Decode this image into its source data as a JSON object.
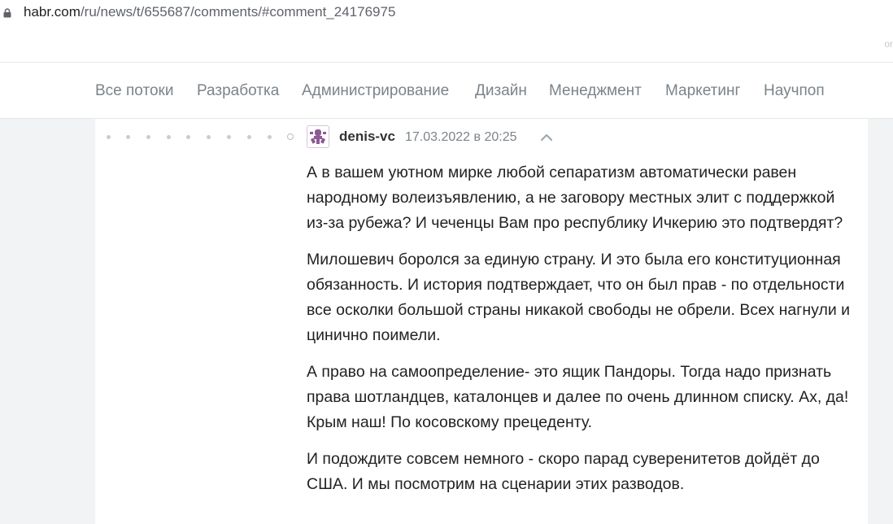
{
  "browser": {
    "url_host": "habr.com",
    "url_path": "/ru/news/t/655687/comments/#comment_24176975"
  },
  "top_strip": {
    "tail_text": "or"
  },
  "nav": {
    "items": [
      {
        "label": "Все потоки"
      },
      {
        "label": "Разработка"
      },
      {
        "label": "Администрирование"
      },
      {
        "label": "Дизайн"
      },
      {
        "label": "Менеджмент"
      },
      {
        "label": "Маркетинг"
      },
      {
        "label": "Научпоп"
      }
    ]
  },
  "comment": {
    "username": "denis-vc",
    "date": "17.03.2022 в 20:25",
    "avatar_color": "#8e5a94",
    "paragraphs": [
      "А в вашем уютном мирке любой сепаратизм автоматически равен народному волеизъявлению, а не заговору местных элит с поддержкой из-за рубежа? И чеченцы Вам про республику Ичкерию это подтвердят?",
      "Милошевич боролся за единую страну. И это была его конституционная обязанность. И история подтверждает, что он был прав - по отдельности все осколки большой страны никакой свободы не обрели. Всех нагнули и цинично поимели.",
      "А право на самоопределение- это ящик Пандоры. Тогда надо признать права шотландцев, каталонцев и далее по очень длинном списку. Ах, да! Крым наш! По косовскому прецеденту.",
      "И подождите совсем немного - скоро парад суверенитетов дойдёт до США. И мы посмотрим на сценарии этих разводов."
    ]
  },
  "colors": {
    "nav_text": "#7b8489",
    "body_text": "#222222",
    "page_bg": "#f1f3f4",
    "accent": "#8e5a94"
  }
}
